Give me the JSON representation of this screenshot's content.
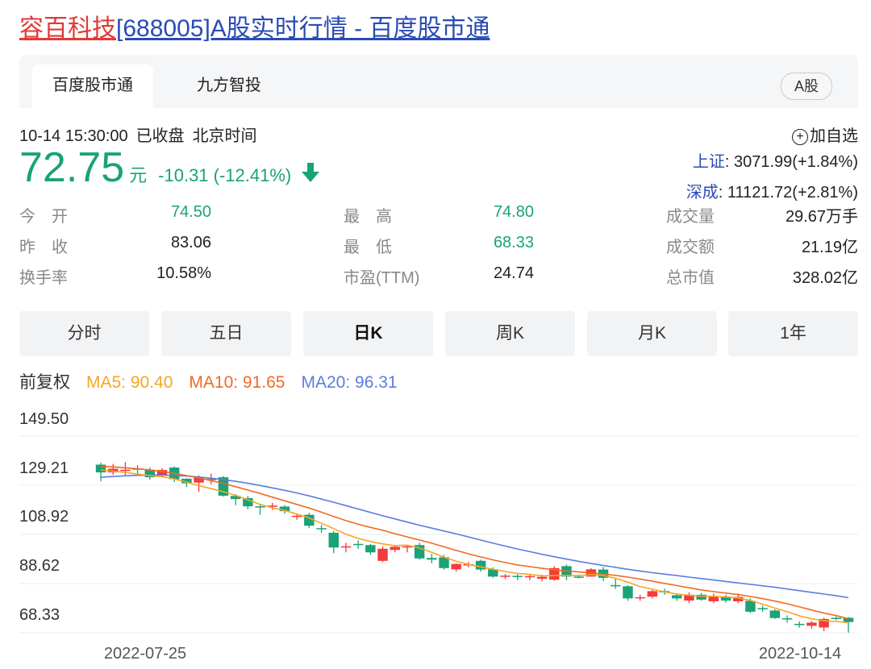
{
  "page": {
    "title_name": "容百科技",
    "title_rest": "[688005]A股实时行情 - 百度股市通"
  },
  "tabs": [
    {
      "label": "百度股市通",
      "active": true
    },
    {
      "label": "九方智投",
      "active": false
    }
  ],
  "market_badge": "A股",
  "quote": {
    "time": "10-14 15:30:00",
    "status": "已收盘",
    "tz": "北京时间",
    "price": "72.75",
    "unit": "元",
    "change": "-10.31 (-12.41%)",
    "direction": "down",
    "add_watch": "加自选"
  },
  "indices": [
    {
      "name": "上证",
      "value": ": 3071.99(+1.84%)"
    },
    {
      "name": "深成",
      "value": ": 11121.72(+2.81%)"
    }
  ],
  "stats": [
    [
      {
        "label": "今　开",
        "value": "74.50",
        "color": "green"
      },
      {
        "label": "最　高",
        "value": "74.80",
        "color": "green"
      },
      {
        "label": "成交量",
        "value": "29.67万手",
        "color": "dark"
      }
    ],
    [
      {
        "label": "昨　收",
        "value": "83.06",
        "color": "dark"
      },
      {
        "label": "最　低",
        "value": "68.33",
        "color": "green"
      },
      {
        "label": "成交额",
        "value": "21.19亿",
        "color": "dark"
      }
    ],
    [
      {
        "label": "换手率",
        "value": "10.58%",
        "color": "dark"
      },
      {
        "label": "市盈(TTM)",
        "value": "24.74",
        "color": "dark"
      },
      {
        "label": "总市值",
        "value": "328.02亿",
        "color": "dark"
      }
    ]
  ],
  "periods": [
    {
      "label": "分时",
      "active": false
    },
    {
      "label": "五日",
      "active": false
    },
    {
      "label": "日K",
      "active": true
    },
    {
      "label": "周K",
      "active": false
    },
    {
      "label": "月K",
      "active": false
    },
    {
      "label": "1年",
      "active": false
    }
  ],
  "ma_legend": {
    "adjust": "前复权",
    "ma5": "MA5: 90.40",
    "ma10": "MA10: 91.65",
    "ma20": "MA20: 96.31"
  },
  "colors": {
    "up": "#f33b3b",
    "down": "#1aa278",
    "ma5": "#f5a623",
    "ma10": "#f06a24",
    "ma20": "#5a7de0",
    "link": "#2a4bb5",
    "title_red": "#e03a36"
  },
  "chart_data": {
    "type": "candlestick",
    "y_ticks": [
      "149.50",
      "129.21",
      "108.92",
      "88.62",
      "68.33"
    ],
    "ylim": [
      68.33,
      149.5
    ],
    "x_labels": [
      "2022-07-25",
      "2022-10-14"
    ],
    "grid": true,
    "candles": [
      [
        137.7,
        134.5,
        138.5,
        130.8
      ],
      [
        134.5,
        136.0,
        138.0,
        133.5
      ],
      [
        135.5,
        135.6,
        138.8,
        133.0
      ],
      [
        136.1,
        135.9,
        137.5,
        133.1
      ],
      [
        135.6,
        132.5,
        136.5,
        131.5
      ],
      [
        133.2,
        135.5,
        136.2,
        132.5
      ],
      [
        136.5,
        131.7,
        137.0,
        130.5
      ],
      [
        131.9,
        130.0,
        132.1,
        128.5
      ],
      [
        130.3,
        132.5,
        133.3,
        126.5
      ],
      [
        131.5,
        131.8,
        134.0,
        129.5
      ],
      [
        132.5,
        124.9,
        133.0,
        124.5
      ],
      [
        124.8,
        123.5,
        125.5,
        121.0
      ],
      [
        123.9,
        120.5,
        124.8,
        119.3
      ],
      [
        120.5,
        120.2,
        121.5,
        117.0
      ],
      [
        120.8,
        120.8,
        122.0,
        119.0
      ],
      [
        120.4,
        118.5,
        121.0,
        117.5
      ],
      [
        116.5,
        116.6,
        117.4,
        115.0
      ],
      [
        117.0,
        112.5,
        117.8,
        111.5
      ],
      [
        111.5,
        111.2,
        112.8,
        109.5
      ],
      [
        109.6,
        103.5,
        110.3,
        101.2
      ],
      [
        104.0,
        104.0,
        105.5,
        101.5
      ],
      [
        105.0,
        104.8,
        106.5,
        103.0
      ],
      [
        104.5,
        101.5,
        105.0,
        100.5
      ],
      [
        98.0,
        103.0,
        104.0,
        97.5
      ],
      [
        102.5,
        103.8,
        104.5,
        101.5
      ],
      [
        104.0,
        104.0,
        104.3,
        101.5
      ],
      [
        104.5,
        99.0,
        105.5,
        98.5
      ],
      [
        99.2,
        98.5,
        100.8,
        97.0
      ],
      [
        99.5,
        95.0,
        100.5,
        94.3
      ],
      [
        94.5,
        96.7,
        97.0,
        93.6
      ],
      [
        96.4,
        96.6,
        97.6,
        95.3
      ],
      [
        98.0,
        94.4,
        98.5,
        93.5
      ],
      [
        94.5,
        91.5,
        95.3,
        91.0
      ],
      [
        91.6,
        91.9,
        92.5,
        90.5
      ],
      [
        91.8,
        91.5,
        92.5,
        90.0
      ],
      [
        91.3,
        91.7,
        92.5,
        90.0
      ],
      [
        90.6,
        91.4,
        92.3,
        89.5
      ],
      [
        90.2,
        95.0,
        95.8,
        89.8
      ],
      [
        95.8,
        91.5,
        96.5,
        90.0
      ],
      [
        91.5,
        91.0,
        92.3,
        90.8
      ],
      [
        91.5,
        94.5,
        95.0,
        91.5
      ],
      [
        94.4,
        91.0,
        95.5,
        89.7
      ],
      [
        88.0,
        87.6,
        90.5,
        86.4
      ],
      [
        87.5,
        82.5,
        88.0,
        81.5
      ],
      [
        83.0,
        83.0,
        84.0,
        81.5
      ],
      [
        83.2,
        85.5,
        86.0,
        82.5
      ],
      [
        85.5,
        85.0,
        86.5,
        84.0
      ],
      [
        83.8,
        82.5,
        84.5,
        81.5
      ],
      [
        81.6,
        84.0,
        85.0,
        80.5
      ],
      [
        84.0,
        82.0,
        84.7,
        81.5
      ],
      [
        81.3,
        83.5,
        84.5,
        80.5
      ],
      [
        83.1,
        81.6,
        84.0,
        80.8
      ],
      [
        81.3,
        83.1,
        84.5,
        80.5
      ],
      [
        81.5,
        77.0,
        82.5,
        76.5
      ],
      [
        78.5,
        78.4,
        79.5,
        77.0
      ],
      [
        77.5,
        74.4,
        78.0,
        74.0
      ],
      [
        74.3,
        74.0,
        75.5,
        72.5
      ],
      [
        72.0,
        71.5,
        73.0,
        70.5
      ],
      [
        71.2,
        72.5,
        73.2,
        70.0
      ],
      [
        70.5,
        74.0,
        74.5,
        69.0
      ],
      [
        74.5,
        74.2,
        75.0,
        73.5
      ],
      [
        74.5,
        72.75,
        74.8,
        68.33
      ]
    ],
    "ma5": [
      135.5,
      135.0,
      134.5,
      133.8,
      133.2,
      132.7,
      131.8,
      130.5,
      129.0,
      127.8,
      126.5,
      125.0,
      123.2,
      121.3,
      119.9,
      118.8,
      117.3,
      115.7,
      113.5,
      111.3,
      109.0,
      107.3,
      106.0,
      105.0,
      104.3,
      104.5,
      103.3,
      101.5,
      99.5,
      97.8,
      96.5,
      95.5,
      94.5,
      93.6,
      92.8,
      92.4,
      91.8,
      91.9,
      92.0,
      91.9,
      92.2,
      92.0,
      90.8,
      89.2,
      87.4,
      86.3,
      85.2,
      84.3,
      83.8,
      83.4,
      83.3,
      83.1,
      82.7,
      81.7,
      80.1,
      78.5,
      77.0,
      75.3,
      74.1,
      73.3,
      73.0,
      72.5
    ],
    "ma10": [
      137.0,
      136.8,
      136.4,
      136.0,
      135.5,
      134.9,
      134.1,
      133.2,
      132.2,
      131.1,
      129.9,
      128.6,
      127.2,
      125.8,
      124.3,
      122.8,
      121.3,
      119.8,
      118.1,
      116.3,
      114.6,
      113.1,
      111.8,
      110.6,
      109.2,
      107.9,
      106.6,
      105.3,
      103.8,
      102.3,
      100.9,
      99.6,
      98.4,
      97.3,
      96.3,
      95.6,
      94.9,
      94.3,
      93.8,
      93.4,
      93.0,
      92.6,
      92.0,
      91.3,
      90.5,
      89.6,
      88.7,
      87.8,
      86.9,
      86.0,
      85.3,
      84.7,
      84.1,
      83.3,
      82.4,
      81.4,
      80.3,
      79.0,
      77.7,
      76.4,
      75.4,
      74.1
    ],
    "ma20": [
      132.5,
      132.8,
      133.1,
      133.3,
      133.4,
      133.4,
      133.2,
      133.0,
      132.6,
      132.1,
      131.5,
      130.8,
      130.0,
      129.1,
      128.1,
      127.1,
      126.0,
      124.8,
      123.5,
      122.2,
      120.8,
      119.4,
      118.0,
      116.6,
      115.3,
      114.0,
      112.7,
      111.5,
      110.3,
      109.1,
      107.9,
      106.6,
      105.3,
      104.1,
      102.9,
      101.8,
      100.7,
      99.7,
      98.7,
      97.8,
      96.9,
      96.1,
      95.3,
      94.5,
      93.8,
      93.1,
      92.5,
      91.9,
      91.3,
      90.7,
      90.1,
      89.5,
      88.9,
      88.3,
      87.7,
      87.1,
      86.4,
      85.7,
      85.0,
      84.3,
      83.6,
      82.8
    ]
  }
}
